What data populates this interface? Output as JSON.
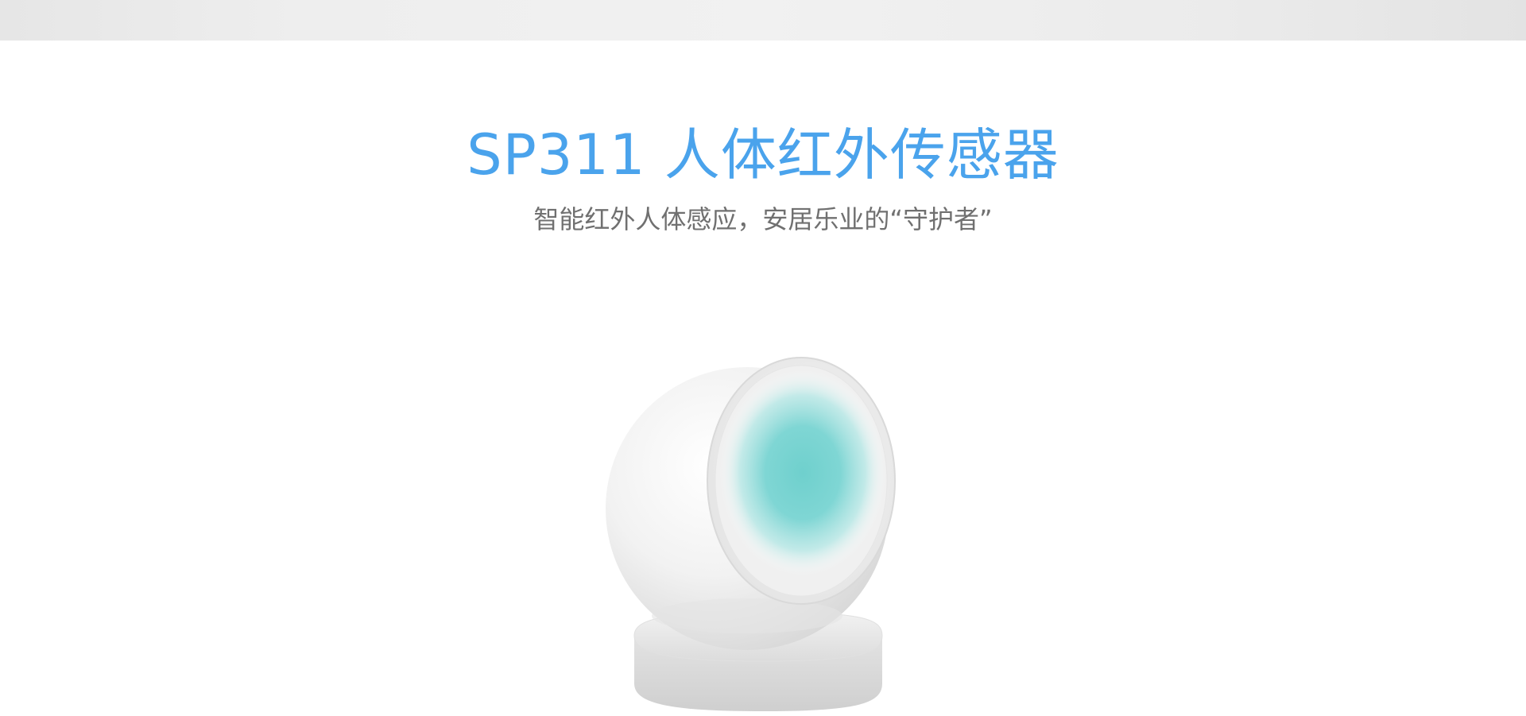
{
  "hero": {
    "title": "SP311 人体红外传感器",
    "subtitle": "智能红外人体感应，安居乐业的“守护者”"
  },
  "product_image": {
    "icon": "motion-sensor-product",
    "accent_color": "#7fd6d4",
    "body_color": "#f3f3f3"
  },
  "colors": {
    "title": "#4aa3ec",
    "subtitle": "#707070",
    "top_band": "#ebebeb"
  }
}
